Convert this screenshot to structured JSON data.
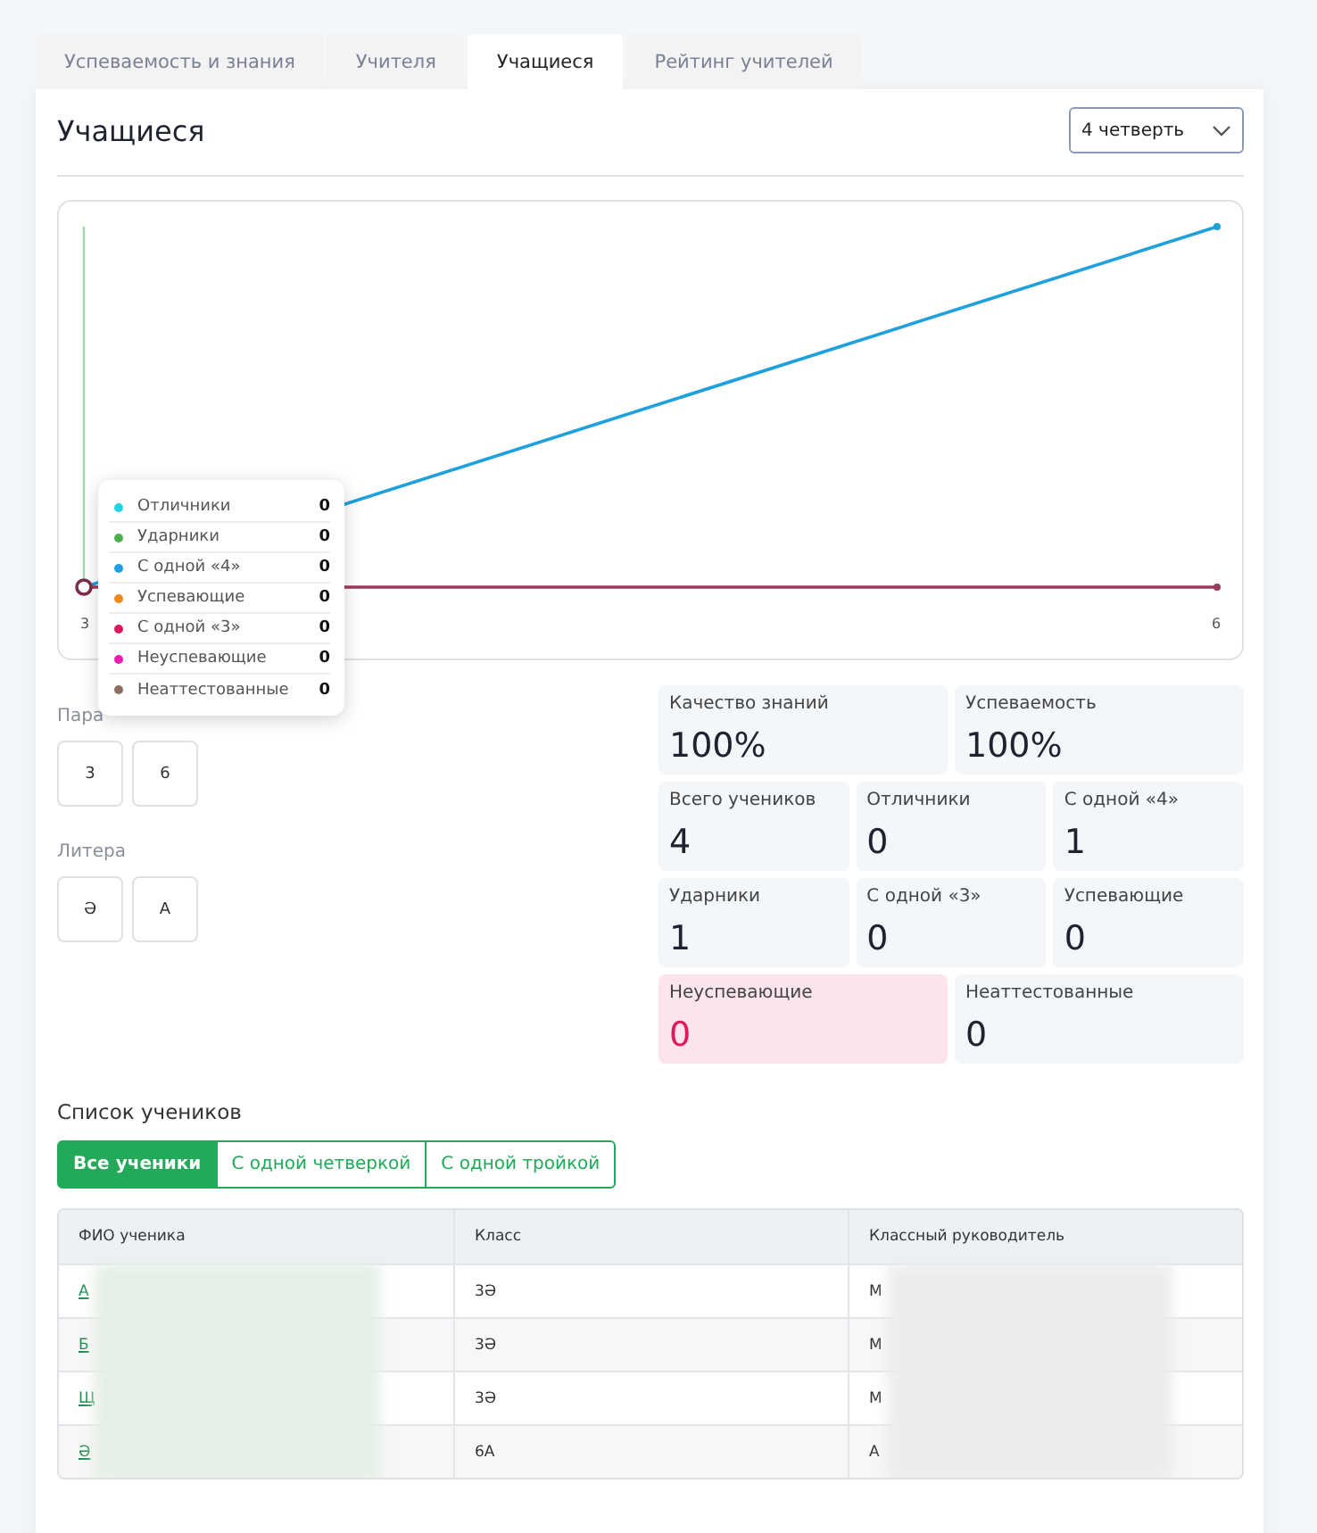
{
  "tabs": [
    {
      "label": "Успеваемость и знания",
      "selected": false
    },
    {
      "label": "Учителя",
      "selected": false
    },
    {
      "label": "Учащиеся",
      "selected": true
    },
    {
      "label": "Рейтинг учителей",
      "selected": false
    }
  ],
  "title": "Учащиеся",
  "period_select": {
    "value": "4 четверть"
  },
  "chart": {
    "x_labels": [
      "3",
      "6"
    ],
    "tooltip": [
      {
        "label": "Отличники",
        "value": "0",
        "color": "#22d3e6"
      },
      {
        "label": "Ударники",
        "value": "0",
        "color": "#4caf50"
      },
      {
        "label": "С одной «4»",
        "value": "0",
        "color": "#1e9fe0"
      },
      {
        "label": "Успевающие",
        "value": "0",
        "color": "#f08a1c"
      },
      {
        "label": "С одной «3»",
        "value": "0",
        "color": "#d81b60"
      },
      {
        "label": "Неуспевающие",
        "value": "0",
        "color": "#e91eb0"
      },
      {
        "label": "Неаттестованные",
        "value": "0",
        "color": "#8d6e63"
      }
    ]
  },
  "filters": [
    {
      "label": "Пара",
      "options": [
        {
          "label": "3",
          "selected": false
        },
        {
          "label": "6",
          "selected": false
        }
      ]
    },
    {
      "label": "Литера",
      "options": [
        {
          "label": "Ә",
          "selected": false
        },
        {
          "label": "А",
          "selected": false
        }
      ]
    }
  ],
  "stats": [
    [
      {
        "label": "Качество знаний",
        "value": "100%",
        "alert": false
      },
      {
        "label": "Успеваемость",
        "value": "100%",
        "alert": false
      }
    ],
    [
      {
        "label": "Всего учеников",
        "value": "4",
        "alert": false
      },
      {
        "label": "Отличники",
        "value": "0",
        "alert": false
      },
      {
        "label": "С одной «4»",
        "value": "1",
        "alert": false
      }
    ],
    [
      {
        "label": "Ударники",
        "value": "1",
        "alert": false
      },
      {
        "label": "С одной «3»",
        "value": "0",
        "alert": false
      },
      {
        "label": "Успевающие",
        "value": "0",
        "alert": false
      }
    ],
    [
      {
        "label": "Неуспевающие",
        "value": "0",
        "alert": true
      },
      {
        "label": "Неаттестованные",
        "value": "0",
        "alert": false
      }
    ]
  ],
  "students": {
    "title": "Список учеников",
    "filter_tabs": [
      {
        "label": "Все ученики",
        "selected": true
      },
      {
        "label": "С одной четверкой",
        "selected": false
      },
      {
        "label": "С одной тройкой",
        "selected": false
      }
    ],
    "columns": [
      "ФИО ученика",
      "Класс",
      "Классный руководитель"
    ],
    "rows": [
      {
        "name": "А",
        "class": "3Ә",
        "teacher": "М"
      },
      {
        "name": "Б",
        "class": "3Ә",
        "teacher": "М"
      },
      {
        "name": "Щ",
        "class": "3Ә",
        "teacher": "М"
      },
      {
        "name": "Ә",
        "class": "6А",
        "teacher": "А"
      }
    ]
  }
}
